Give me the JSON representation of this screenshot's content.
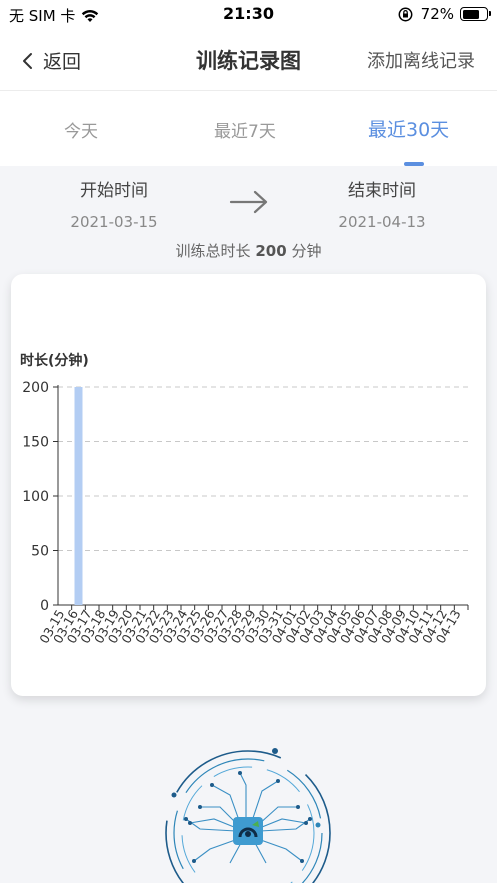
{
  "status_bar": {
    "carrier": "无 SIM 卡",
    "time": "21:30",
    "battery": "72%",
    "battery_level": 0.72
  },
  "nav": {
    "back_label": "返回",
    "title": "训练记录图",
    "action_label": "添加离线记录"
  },
  "tabs": [
    {
      "label": "今天",
      "active": false
    },
    {
      "label": "最近7天",
      "active": false
    },
    {
      "label": "最近30天",
      "active": true
    }
  ],
  "range": {
    "start_label": "开始时间",
    "start_date": "2021-03-15",
    "end_label": "结束时间",
    "end_date": "2021-04-13",
    "total_prefix": "训练总时长",
    "total_value": "200",
    "total_unit": "分钟"
  },
  "colors": {
    "accent": "#5b8fe0",
    "bar": "#b3cdf3"
  },
  "chart_data": {
    "type": "bar",
    "ylabel": "时长(分钟)",
    "ylim": [
      0,
      200
    ],
    "yticks": [
      0,
      50,
      100,
      150,
      200
    ],
    "grid": "dashed-horizontal",
    "categories": [
      "03-15",
      "03-16",
      "03-17",
      "03-18",
      "03-19",
      "03-20",
      "03-21",
      "03-22",
      "03-23",
      "03-24",
      "03-25",
      "03-26",
      "03-27",
      "03-28",
      "03-29",
      "03-30",
      "03-31",
      "04-01",
      "04-02",
      "04-03",
      "04-04",
      "04-05",
      "04-06",
      "04-07",
      "04-08",
      "04-09",
      "04-10",
      "04-11",
      "04-12",
      "04-13"
    ],
    "values": [
      0,
      200,
      0,
      0,
      0,
      0,
      0,
      0,
      0,
      0,
      0,
      0,
      0,
      0,
      0,
      0,
      0,
      0,
      0,
      0,
      0,
      0,
      0,
      0,
      0,
      0,
      0,
      0,
      0,
      0
    ]
  }
}
